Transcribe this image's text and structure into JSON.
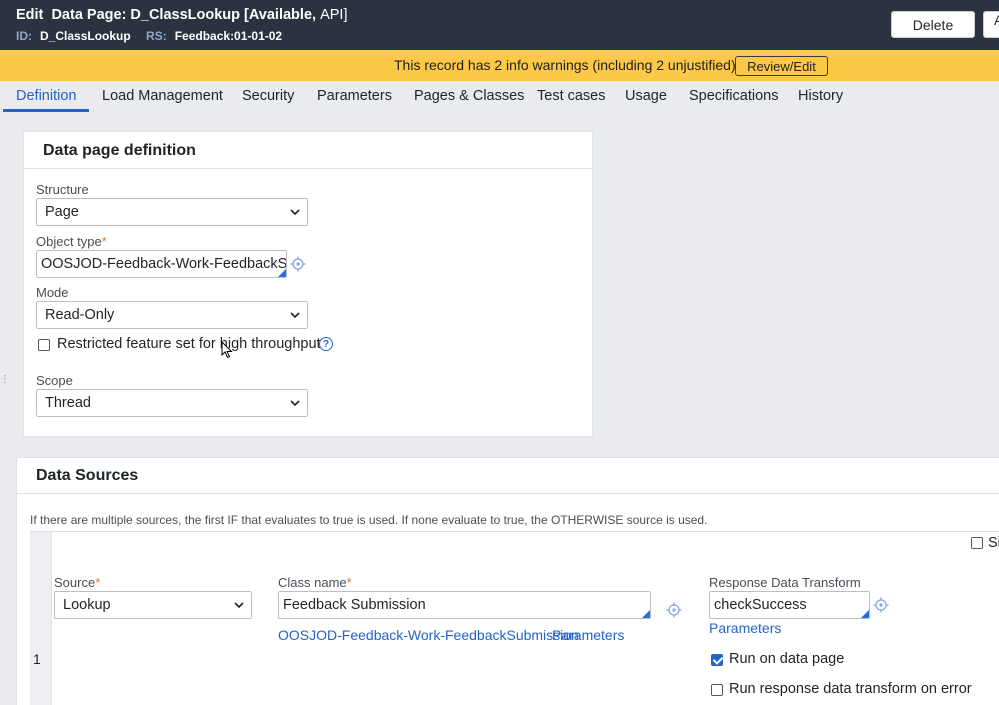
{
  "header": {
    "edit_label": "Edit",
    "record_title": "Data Page: D_ClassLookup",
    "status_open": "[Available,",
    "status_type": "API]",
    "id_label": "ID:",
    "id_value": "D_ClassLookup",
    "rs_label": "RS:",
    "rs_value": "Feedback:01-01-02",
    "delete_label": "Delete",
    "next_label": "A"
  },
  "warning": {
    "text": "This record has 2 info warnings (including 2 unjustified)",
    "review_label": "Review/Edit"
  },
  "tabs": [
    {
      "label": "Definition",
      "active": true
    },
    {
      "label": "Load Management"
    },
    {
      "label": "Security"
    },
    {
      "label": "Parameters"
    },
    {
      "label": "Pages & Classes"
    },
    {
      "label": "Test cases"
    },
    {
      "label": "Usage"
    },
    {
      "label": "Specifications"
    },
    {
      "label": "History"
    }
  ],
  "definition": {
    "title": "Data page definition",
    "structure_label": "Structure",
    "structure_value": "Page",
    "object_type_label": "Object type",
    "object_type_value": "OOSJOD-Feedback-Work-FeedbackSubm",
    "mode_label": "Mode",
    "mode_value": "Read-Only",
    "restricted_label": "Restricted feature set for high throughput",
    "restricted_checked": false,
    "scope_label": "Scope",
    "scope_value": "Thread"
  },
  "data_sources": {
    "title": "Data Sources",
    "hint": "If there are multiple sources, the first IF that evaluates to true is used. If none evaluate to true, the OTHERWISE source is used.",
    "simulate_label": "Si",
    "row_number": "1",
    "source_label": "Source",
    "source_value": "Lookup",
    "class_name_label": "Class name",
    "class_name_value": "Feedback Submission",
    "class_link": "OOSJOD-Feedback-Work-FeedbackSubmission",
    "class_params_link": "Parameters",
    "response_dt_label": "Response Data Transform",
    "response_dt_value": "checkSuccess",
    "response_params_link": "Parameters",
    "run_on_page_label": "Run on data page",
    "run_on_page_checked": true,
    "run_on_error_label": "Run response data transform on error",
    "run_on_error_checked": false
  },
  "colors": {
    "header_bg": "#2b3240",
    "warning_bg": "#fcc848",
    "accent": "#2563c4",
    "required": "#e07a1f"
  }
}
